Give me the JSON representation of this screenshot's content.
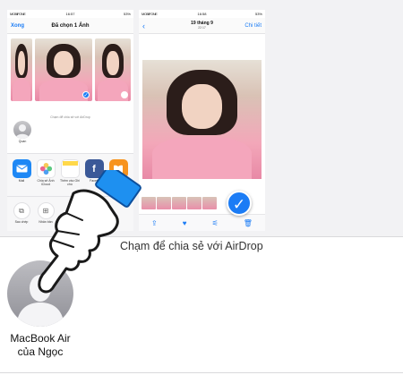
{
  "left_phone": {
    "status": {
      "carrier": "MOBIFONE",
      "time": "16:57",
      "battery": "53%"
    },
    "nav": {
      "done_label": "Xong",
      "title": "Đã chọn 1 Ảnh"
    },
    "airdrop_hint": "Chạm để chia sẻ với AirDrop",
    "contact_name": "Quan",
    "apps": [
      {
        "icon": "mail-icon",
        "label": "Mail",
        "color": "#1e88f5"
      },
      {
        "icon": "photos-icon",
        "label": "Chia sẻ Ảnh iCloud",
        "color": "#ffffff"
      },
      {
        "icon": "notes-icon",
        "label": "Thêm vào Ghi chú",
        "color": "#ffd84a"
      },
      {
        "icon": "facebook-icon",
        "label": "Faceb",
        "color": "#3b5998"
      },
      {
        "icon": "books-icon",
        "label": "",
        "color": "#f7931e"
      }
    ],
    "actions": [
      {
        "icon": "copy-icon",
        "label": "Sao chép"
      },
      {
        "icon": "duplicate-icon",
        "label": "Nhân bản"
      }
    ]
  },
  "right_phone": {
    "status": {
      "carrier": "MOBIFONE",
      "time": "16:58",
      "battery": "53%"
    },
    "nav": {
      "date": "19 tháng 9",
      "time": "22:17",
      "detail_label": "Chi tiết"
    }
  },
  "caption": "Chạm để chia sẻ với AirDrop",
  "airdrop_contact": {
    "name": "MacBook Air của Ngọc"
  },
  "colors": {
    "accent": "#1b7cf5",
    "hand_cuff": "#1e90f0"
  }
}
